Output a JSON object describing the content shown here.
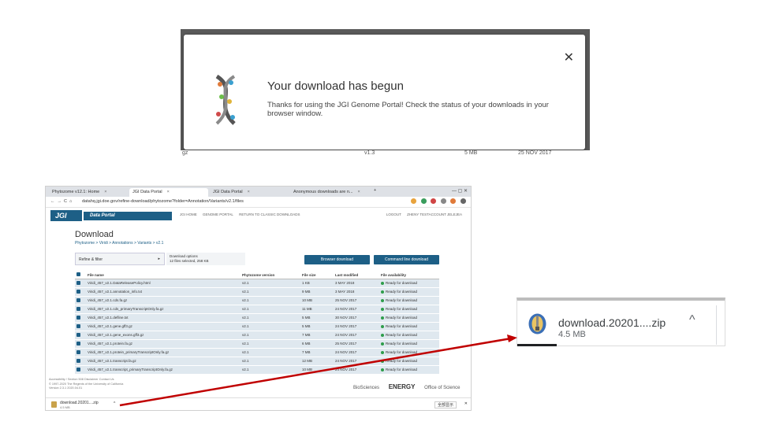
{
  "modal": {
    "title": "Your download has begun",
    "message": "Thanks for using the JGI Genome Portal! Check the status of your downloads in your browser window.",
    "close_glyph": "✕",
    "under_row": {
      "name": "gz",
      "version": "v1.3",
      "size": "5 MB",
      "date": "25 NOV 2017"
    }
  },
  "browser": {
    "tabs": [
      {
        "label": "Phytozome v12.1: Home",
        "active": false
      },
      {
        "label": "JGI Data Portal",
        "active": true
      },
      {
        "label": "JGI Data Portal",
        "active": false
      },
      {
        "label": "Anonymous downloads are n...",
        "active": false
      }
    ],
    "window_controls": "—  ▢  ✕",
    "nav_glyphs": "←→C⌂",
    "url": "datahq.jgi.doe.gov/refine-download/phytozome?folder=Annotation/Variants/v2.1/files",
    "header": {
      "logo": "JGI",
      "portal": "Data Portal",
      "links": [
        "JGI HOME",
        "GENOME PORTAL",
        "RETURN TO CLASSIC DOWNLOADS"
      ],
      "user_links": [
        "LOGOUT",
        "ZHENY TESTACCOUNT JELEJEA"
      ]
    },
    "page_title": "Download",
    "breadcrumb": "Phytozome  >  Viridi  >  Annotations  >  Variants  >  v2.1",
    "refine_label": "Refine & filter",
    "download_options": {
      "title": "Download options",
      "subtitle": "12 files selected, 258 KB"
    },
    "browser_download_btn": "Browser download",
    "commandline_btn": "Command line download",
    "table": {
      "headers": [
        "File name",
        "Phytozome version",
        "File size",
        "Last modified",
        "File availability"
      ],
      "rows": [
        [
          "Viridi_457_v2.1.DataReleasePolicy.html",
          "v2.1",
          "1 KB",
          "3 MAY 2018",
          "Ready for download"
        ],
        [
          "Viridi_457_v2.1.annotation_info.txt",
          "v2.1",
          "9 MB",
          "3 MAY 2018",
          "Ready for download"
        ],
        [
          "Viridi_457_v2.1.cds.fa.gz",
          "v2.1",
          "10 MB",
          "25 NOV 2017",
          "Ready for download"
        ],
        [
          "Viridi_457_v2.1.cds_primaryTranscriptOnly.fa.gz",
          "v2.1",
          "11 MB",
          "24 NOV 2017",
          "Ready for download"
        ],
        [
          "Viridi_457_v2.1.defline.txt",
          "v2.1",
          "5 MB",
          "30 NOV 2017",
          "Ready for download"
        ],
        [
          "Viridi_457_v2.1.gene.gff3.gz",
          "v2.1",
          "5 MB",
          "24 NOV 2017",
          "Ready for download"
        ],
        [
          "Viridi_457_v2.1.gene_exons.gff3.gz",
          "v2.1",
          "7 MB",
          "24 NOV 2017",
          "Ready for download"
        ],
        [
          "Viridi_457_v2.1.protein.fa.gz",
          "v2.1",
          "6 MB",
          "25 NOV 2017",
          "Ready for download"
        ],
        [
          "Viridi_457_v2.1.protein_primaryTranscriptOnly.fa.gz",
          "v2.1",
          "7 MB",
          "24 NOV 2017",
          "Ready for download"
        ],
        [
          "Viridi_457_v2.1.transcript.fa.gz",
          "v2.1",
          "12 MB",
          "24 NOV 2017",
          "Ready for download"
        ],
        [
          "Viridi_457_v2.1.transcript_primaryTranscriptOnly.fa.gz",
          "v2.1",
          "10 MB",
          "24 NOV 2017",
          "Ready for download"
        ]
      ]
    },
    "footer": {
      "lines": [
        "Accessibility / Section 508   Disclaimer   Contact Us",
        "© 1997-2020 The Regents of the University of California",
        "Version 2.3.1 2020.04.01"
      ],
      "logos": [
        "BioSciences",
        "ENERGY",
        "Office of Science"
      ]
    },
    "download_bar": {
      "name": "download.20201....zip",
      "size": "4.5 MB",
      "show_all": "全部显示",
      "close": "✕"
    }
  },
  "zoomed_download": {
    "file_name": "download.20201....zip",
    "size": "4.5 MB",
    "chevron": "^"
  },
  "colors": {
    "jgi_blue": "#1d5f86",
    "arrow": "#c00000",
    "row_bg": "#dfe8ef"
  }
}
